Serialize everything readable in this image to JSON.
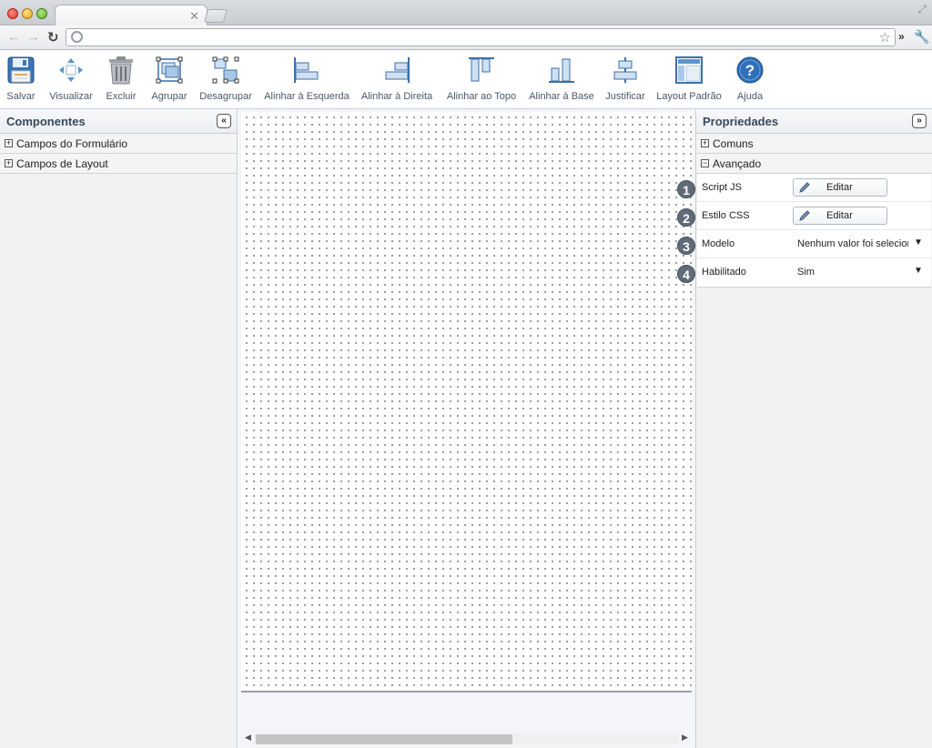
{
  "toolbar": {
    "tools": [
      {
        "label": "Salvar"
      },
      {
        "label": "Visualizar"
      },
      {
        "label": "Excluir"
      },
      {
        "label": "Agrupar"
      },
      {
        "label": "Desagrupar"
      },
      {
        "label": "Alinhar à Esquerda"
      },
      {
        "label": "Alinhar à Direita"
      },
      {
        "label": "Alinhar ao Topo"
      },
      {
        "label": "Alinhar à Base"
      },
      {
        "label": "Justificar"
      },
      {
        "label": "Layout Padrão"
      },
      {
        "label": "Ajuda"
      }
    ]
  },
  "left_panel": {
    "title": "Componentes",
    "collapse": "«",
    "groups": [
      {
        "label": "Campos do Formulário",
        "state": "+"
      },
      {
        "label": "Campos de Layout",
        "state": "+"
      }
    ]
  },
  "right_panel": {
    "title": "Propriedades",
    "collapse": "»",
    "groups": [
      {
        "label": "Comuns",
        "state": "+"
      },
      {
        "label": "Avançado",
        "state": "−"
      }
    ],
    "properties": [
      {
        "label": "Script JS",
        "button": "Editar"
      },
      {
        "label": "Estilo CSS",
        "button": "Editar"
      },
      {
        "label": "Modelo",
        "value": "Nenhum valor foi selecionado"
      },
      {
        "label": "Habilitado",
        "value": "Sim"
      }
    ]
  },
  "badges": [
    "1",
    "2",
    "3",
    "4"
  ],
  "icons": {
    "save": "floppy-disk-icon",
    "preview": "move-arrows-icon",
    "delete": "trash-can-icon",
    "help": "question-circle-icon"
  },
  "colors": {
    "accent": "#2f7fc1",
    "panel_title": "#36495c",
    "badge": "#5f6b79"
  }
}
